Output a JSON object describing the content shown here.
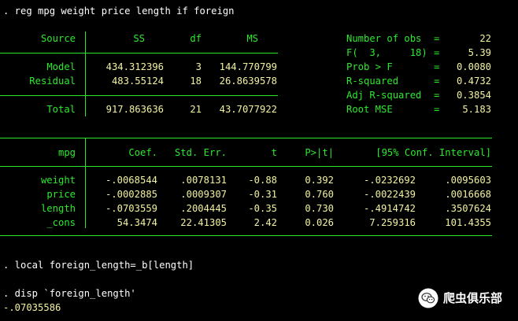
{
  "commands": {
    "regress": ". reg mpg weight price length if foreign",
    "local": ". local foreign_length=_b[length]",
    "disp": ". disp `foreign_length'",
    "disp_result": "-.07035586"
  },
  "anova": {
    "headers": {
      "source": "Source",
      "ss": "SS",
      "df": "df",
      "ms": "MS"
    },
    "rows": [
      {
        "label": "Model",
        "ss": "434.312396",
        "df": "3",
        "ms": "144.770799"
      },
      {
        "label": "Residual",
        "ss": "483.55124",
        "df": "18",
        "ms": "26.8639578"
      }
    ],
    "total": {
      "label": "Total",
      "ss": "917.863636",
      "df": "21",
      "ms": "43.7077922"
    }
  },
  "stats": [
    {
      "label": "Number of obs",
      "eq": "=",
      "value": "22"
    },
    {
      "label": "F(  3,     18)",
      "eq": "=",
      "value": "5.39"
    },
    {
      "label": "Prob > F",
      "eq": "=",
      "value": "0.0080"
    },
    {
      "label": "R-squared",
      "eq": "=",
      "value": "0.4732"
    },
    {
      "label": "Adj R-squared",
      "eq": "=",
      "value": "0.3854"
    },
    {
      "label": "Root MSE",
      "eq": "=",
      "value": "5.183"
    }
  ],
  "coef": {
    "headers": {
      "depvar": "mpg",
      "coef": "Coef.",
      "se": "Std. Err.",
      "t": "t",
      "p": "P>|t|",
      "ci": "[95% Conf. Interval]"
    },
    "rows": [
      {
        "var": "weight",
        "coef": "-.0068544",
        "se": ".0078131",
        "t": "-0.88",
        "p": "0.392",
        "lo": "-.0232692",
        "hi": ".0095603"
      },
      {
        "var": "price",
        "coef": "-.0002885",
        "se": ".0009307",
        "t": "-0.31",
        "p": "0.760",
        "lo": "-.0022439",
        "hi": ".0016668"
      },
      {
        "var": "length",
        "coef": "-.0703559",
        "se": ".2004445",
        "t": "-0.35",
        "p": "0.730",
        "lo": "-.4914742",
        "hi": ".3507624"
      },
      {
        "var": "_cons",
        "coef": "54.3474",
        "se": "22.41305",
        "t": "2.42",
        "p": "0.026",
        "lo": "7.259316",
        "hi": "101.4355"
      }
    ]
  },
  "watermark": {
    "icon": "wechat-icon",
    "text": "爬虫俱乐部"
  }
}
